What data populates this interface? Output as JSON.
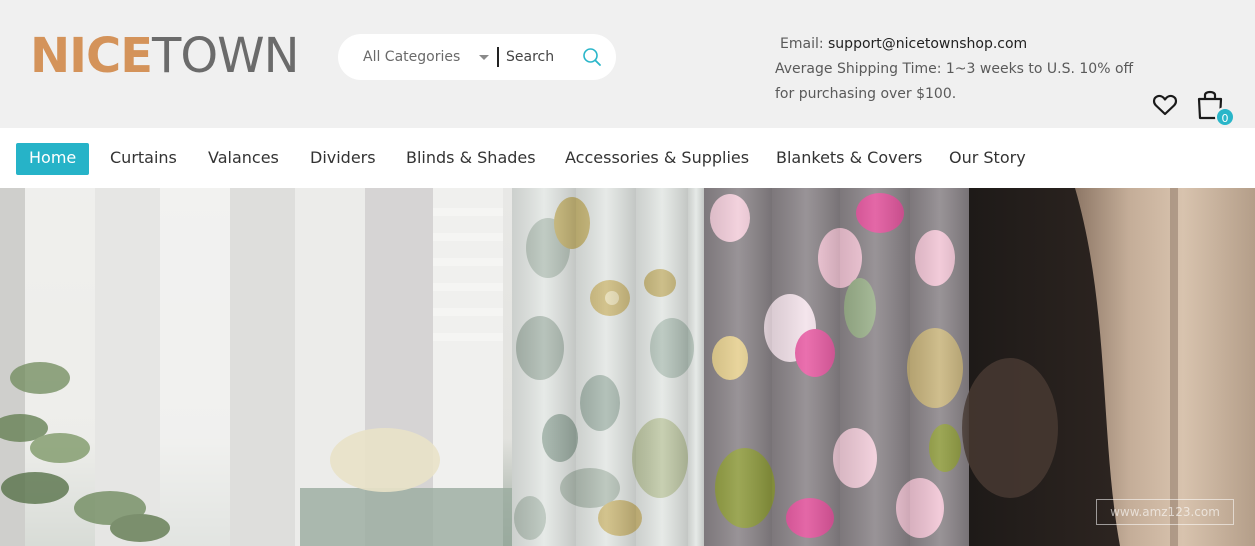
{
  "brand": {
    "logo_nice": "NICE",
    "logo_town": "TOWN",
    "colors": {
      "logo_accent": "#d4935a",
      "logo_gray": "#6b6b6b",
      "accent": "#26b3c8"
    }
  },
  "search": {
    "category": "All Categories",
    "placeholder": "Search",
    "icon": "search-icon"
  },
  "contact": {
    "email_label": "Email:",
    "email_value": "support@nicetownshop.com",
    "shipping_text": "Average Shipping Time: 1~3 weeks to U.S. 10% off for purchasing over $100."
  },
  "header_icons": {
    "wishlist_icon": "heart-icon",
    "cart_icon": "shopping-bag-icon",
    "cart_count": "0"
  },
  "nav": {
    "items": [
      {
        "label": "Home",
        "active": true
      },
      {
        "label": "Curtains"
      },
      {
        "label": "Valances"
      },
      {
        "label": "Dividers"
      },
      {
        "label": "Blinds & Shades"
      },
      {
        "label": "Accessories & Supplies"
      },
      {
        "label": "Blankets & Covers"
      },
      {
        "label": "Our Story"
      }
    ]
  },
  "hero": {
    "watermark": "www.amz123.com"
  }
}
